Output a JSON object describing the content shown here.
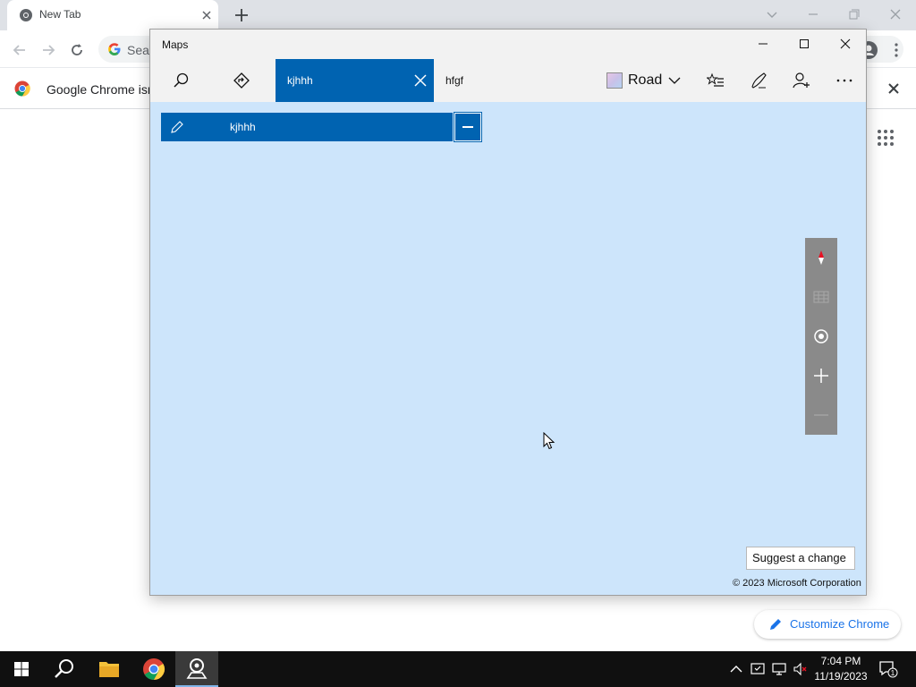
{
  "chrome": {
    "tab_title": "New Tab",
    "omnibox_placeholder": "Sear",
    "infobar_text": "Google Chrome isn't",
    "customize_label": "Customize Chrome"
  },
  "maps": {
    "window_title": "Maps",
    "active_tab_label": "kjhhh",
    "inactive_tab_label": "hfgf",
    "map_style_label": "Road",
    "route_entry_label": "kjhhh",
    "suggest_change_label": "Suggest a change",
    "copyright": "© 2023 Microsoft Corporation"
  },
  "taskbar": {
    "time": "7:04 PM",
    "date": "11/19/2023",
    "notification_count": "1"
  },
  "colors": {
    "accent": "#0063b1",
    "map_background": "#cde5fb",
    "chrome_link": "#1a73e8"
  }
}
